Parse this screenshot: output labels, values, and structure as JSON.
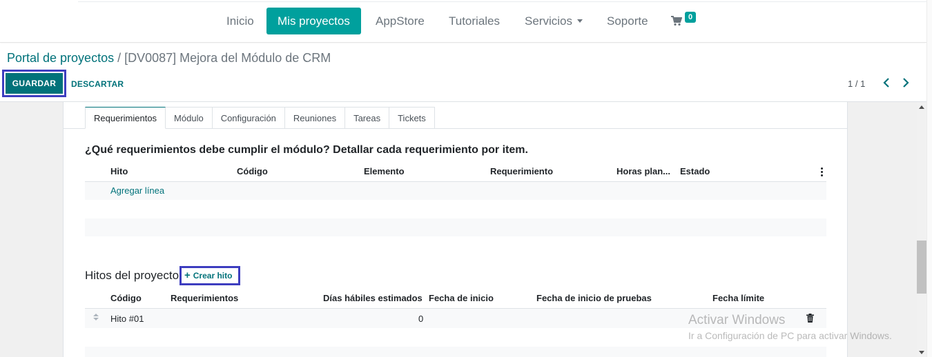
{
  "navbar": {
    "items": [
      "Inicio",
      "Mis proyectos",
      "AppStore",
      "Tutoriales",
      "Servicios",
      "Soporte"
    ],
    "cart_count": "0",
    "accent_color": "#00a09d"
  },
  "breadcrumb": {
    "parent": "Portal de proyectos",
    "separator": " / ",
    "current": "[DV0087] Mejora del Módulo de CRM"
  },
  "actions": {
    "save": "GUARDAR",
    "discard": "DESCARTAR"
  },
  "pager": {
    "value": "1 / 1"
  },
  "tabs": [
    "Requerimientos",
    "Módulo",
    "Configuración",
    "Reuniones",
    "Tareas",
    "Tickets"
  ],
  "requirements": {
    "title": "¿Qué requerimientos debe cumplir el módulo? Detallar cada requerimiento por item.",
    "columns": [
      "Hito",
      "Código",
      "Elemento",
      "Requerimiento",
      "Horas plan...",
      "Estado"
    ],
    "add_line": "Agregar línea"
  },
  "milestones": {
    "title": "Hitos del proyecto",
    "create_button": "Crear hito",
    "columns": [
      "Código",
      "Requerimientos",
      "Días hábiles estimados",
      "Fecha de inicio",
      "Fecha de inicio de pruebas",
      "Fecha límite"
    ],
    "rows": [
      {
        "codigo": "Hito #01",
        "requerimientos": "",
        "dias": "0",
        "fecha_inicio": "",
        "fecha_pruebas": "",
        "fecha_limite": ""
      }
    ]
  },
  "watermark": {
    "line1": "Activar Windows",
    "line2": "Ir a Configuración de PC para activar Windows."
  },
  "icons": [
    "cart-icon",
    "chevron-left-icon",
    "chevron-right-icon",
    "plus-icon",
    "trash-icon",
    "drag-handle-icon",
    "kebab-menu-icon"
  ]
}
